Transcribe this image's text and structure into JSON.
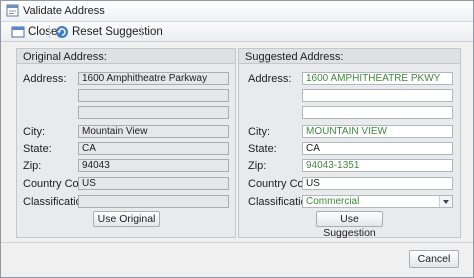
{
  "window": {
    "title": "Validate Address"
  },
  "toolbar": {
    "close_label": "Close",
    "reset_label": "Reset Suggestion"
  },
  "original": {
    "group_title": "Original Address:",
    "labels": {
      "address": "Address:",
      "city": "City:",
      "state": "State:",
      "zip": "Zip:",
      "country": "Country Code:",
      "classification": "Classification:"
    },
    "values": {
      "address1": "1600 Amphitheatre Parkway",
      "address2": "",
      "address3": "",
      "city": "Mountain View",
      "state": "CA",
      "zip": "94043",
      "country": "US",
      "classification": ""
    },
    "button_label": "Use Original"
  },
  "suggested": {
    "group_title": "Suggested Address:",
    "labels": {
      "address": "Address:",
      "city": "City:",
      "state": "State:",
      "zip": "Zip:",
      "country": "Country Code:",
      "classification": "Classification:"
    },
    "values": {
      "address1": "1600 AMPHITHEATRE PKWY",
      "address2": "",
      "address3": "",
      "city": "MOUNTAIN VIEW",
      "state": "CA",
      "zip": "94043-1351",
      "country": "US",
      "classification": "Commercial"
    },
    "button_label": "Use Suggestion"
  },
  "footer": {
    "cancel_label": "Cancel"
  },
  "colors": {
    "suggested_changed_text": "#3c8a3c",
    "panel_bg": "#e9eaec"
  },
  "icons": {
    "title": "form-icon",
    "close": "close-window-icon",
    "reset": "refresh-icon"
  }
}
